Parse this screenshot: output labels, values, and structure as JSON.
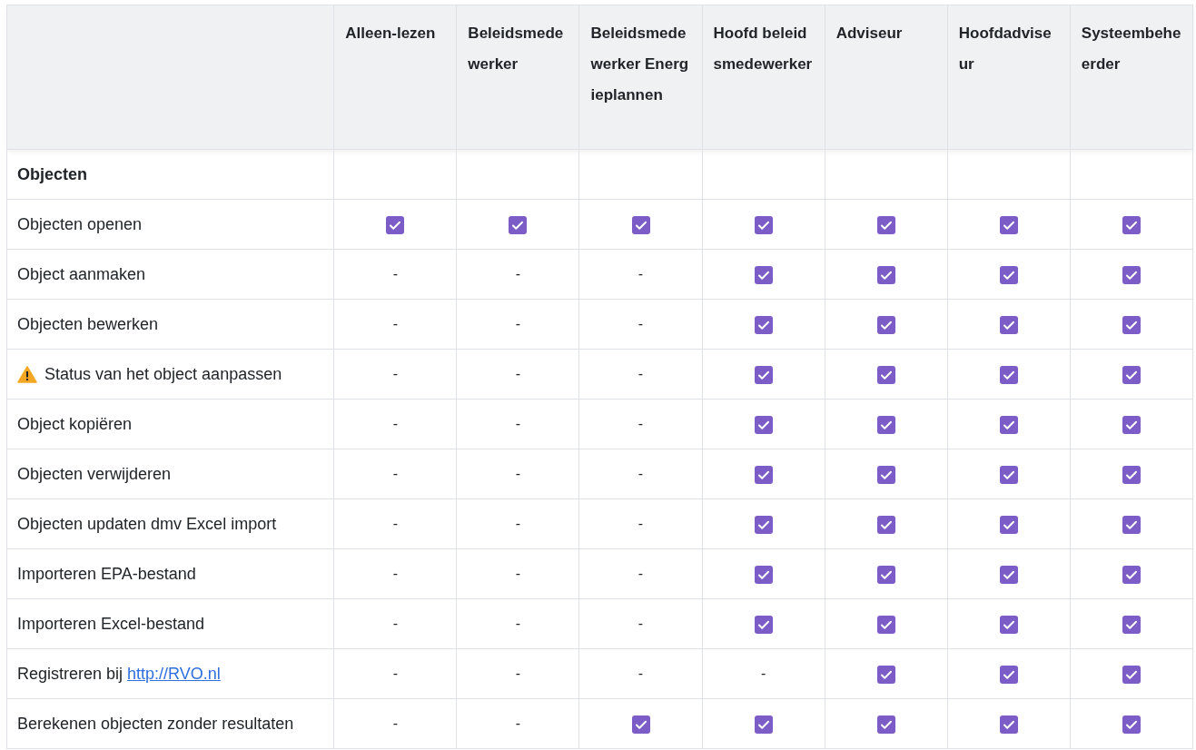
{
  "table": {
    "columns": [
      "Alleen-lezen",
      "Beleidsmedewerker",
      "Beleidsmedewerker Energieplannen",
      "Hoofd beleidsmedewerker",
      "Adviseur",
      "Hoofdadviseur",
      "Systeembeheerder"
    ],
    "rows": [
      {
        "kind": "section",
        "label": "Objecten"
      },
      {
        "kind": "permission",
        "label": "Objecten openen",
        "warning": false,
        "cells": [
          {
            "checked": true
          },
          {
            "checked": true
          },
          {
            "checked": true
          },
          {
            "checked": true
          },
          {
            "checked": true
          },
          {
            "checked": true
          },
          {
            "checked": true
          }
        ]
      },
      {
        "kind": "permission",
        "label": "Object aanmaken",
        "warning": false,
        "cells": [
          {
            "checked": false,
            "text": "-"
          },
          {
            "checked": false,
            "text": "-"
          },
          {
            "checked": false,
            "text": "-"
          },
          {
            "checked": true
          },
          {
            "checked": true
          },
          {
            "checked": true
          },
          {
            "checked": true
          }
        ]
      },
      {
        "kind": "permission",
        "label": "Objecten bewerken",
        "warning": false,
        "cells": [
          {
            "checked": false,
            "text": "-"
          },
          {
            "checked": false,
            "text": "-"
          },
          {
            "checked": false,
            "text": "-"
          },
          {
            "checked": true
          },
          {
            "checked": true
          },
          {
            "checked": true
          },
          {
            "checked": true
          }
        ]
      },
      {
        "kind": "permission",
        "label": "Status van het object aanpassen",
        "warning": true,
        "cells": [
          {
            "checked": false,
            "text": "-"
          },
          {
            "checked": false,
            "text": "-"
          },
          {
            "checked": false,
            "text": "-"
          },
          {
            "checked": true
          },
          {
            "checked": true
          },
          {
            "checked": true
          },
          {
            "checked": true
          }
        ]
      },
      {
        "kind": "permission",
        "label": "Object kopiëren",
        "warning": false,
        "cells": [
          {
            "checked": false,
            "text": "-"
          },
          {
            "checked": false,
            "text": "-"
          },
          {
            "checked": false,
            "text": "-"
          },
          {
            "checked": true
          },
          {
            "checked": true
          },
          {
            "checked": true
          },
          {
            "checked": true
          }
        ]
      },
      {
        "kind": "permission",
        "label": "Objecten verwijderen",
        "warning": false,
        "cells": [
          {
            "checked": false,
            "text": "-"
          },
          {
            "checked": false,
            "text": "-"
          },
          {
            "checked": false,
            "text": "-"
          },
          {
            "checked": true
          },
          {
            "checked": true
          },
          {
            "checked": true
          },
          {
            "checked": true
          }
        ]
      },
      {
        "kind": "permission",
        "label": "Objecten updaten dmv Excel import",
        "warning": false,
        "cells": [
          {
            "checked": false,
            "text": "-"
          },
          {
            "checked": false,
            "text": "-"
          },
          {
            "checked": false,
            "text": "-"
          },
          {
            "checked": true
          },
          {
            "checked": true
          },
          {
            "checked": true
          },
          {
            "checked": true
          }
        ]
      },
      {
        "kind": "permission",
        "label": "Importeren EPA-bestand",
        "warning": false,
        "cells": [
          {
            "checked": false,
            "text": "-"
          },
          {
            "checked": false,
            "text": "-"
          },
          {
            "checked": false,
            "text": "-"
          },
          {
            "checked": true
          },
          {
            "checked": true
          },
          {
            "checked": true
          },
          {
            "checked": true
          }
        ]
      },
      {
        "kind": "permission",
        "label": "Importeren Excel-bestand",
        "warning": false,
        "cells": [
          {
            "checked": false,
            "text": "-"
          },
          {
            "checked": false,
            "text": "-"
          },
          {
            "checked": false,
            "text": "-"
          },
          {
            "checked": true
          },
          {
            "checked": true
          },
          {
            "checked": true
          },
          {
            "checked": true
          }
        ]
      },
      {
        "kind": "permission",
        "label": "Registreren bij",
        "link": "http://RVO.nl",
        "warning": false,
        "cells": [
          {
            "checked": false,
            "text": "-"
          },
          {
            "checked": false,
            "text": "-"
          },
          {
            "checked": false,
            "text": "-"
          },
          {
            "checked": false,
            "text": "-"
          },
          {
            "checked": true
          },
          {
            "checked": true
          },
          {
            "checked": true
          }
        ]
      },
      {
        "kind": "permission",
        "label": "Berekenen objecten zonder resultaten",
        "warning": false,
        "cells": [
          {
            "checked": false,
            "text": "-"
          },
          {
            "checked": false,
            "text": "-"
          },
          {
            "checked": true
          },
          {
            "checked": true
          },
          {
            "checked": true
          },
          {
            "checked": true
          },
          {
            "checked": true
          }
        ]
      }
    ]
  }
}
